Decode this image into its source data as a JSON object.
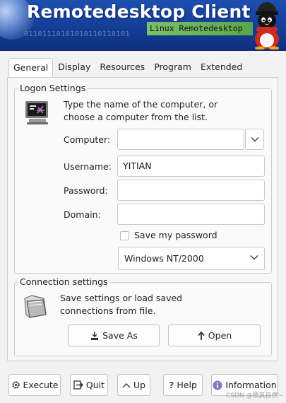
{
  "banner": {
    "title": "Remotedesktop Client",
    "subtitle": "Linux Remotedesktop",
    "binary": "01101110101010110110101"
  },
  "tabs": [
    {
      "label": "General",
      "active": true
    },
    {
      "label": "Display"
    },
    {
      "label": "Resources"
    },
    {
      "label": "Program"
    },
    {
      "label": "Extended"
    }
  ],
  "logon": {
    "title": "Logon Settings",
    "desc_line1": "Type the name of the computer, or",
    "desc_line2": "choose a computer from the list.",
    "computer_label": "Computer:",
    "computer_value": "",
    "username_label": "Username:",
    "username_value": "YITIAN",
    "password_label": "Password:",
    "password_value": "",
    "domain_label": "Domain:",
    "domain_value": "",
    "save_password_label": "Save my password",
    "save_password_checked": false,
    "os_selected": "Windows NT/2000"
  },
  "connection": {
    "title": "Connection settings",
    "desc_line1": "Save settings or load saved",
    "desc_line2": "connections from file.",
    "save_as_label": "Save As",
    "open_label": "Open"
  },
  "footer": {
    "execute_label": "Execute",
    "quit_label": "Quit",
    "up_label": "Up",
    "help_label": "Help",
    "information_label": "Information"
  },
  "watermark": "CSDN @顺其自然~",
  "colors": {
    "banner_blue": "#16409c",
    "subtitle_green": "#6cb45a",
    "info_purple": "#8a74c8"
  }
}
